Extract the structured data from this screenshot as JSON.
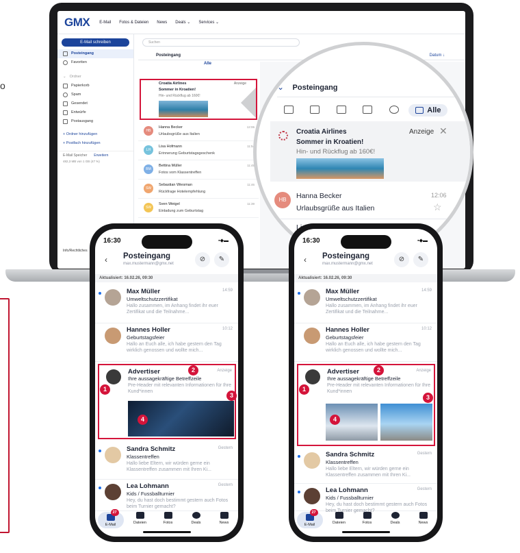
{
  "side_letter": "o",
  "laptop": {
    "logo": "GMX",
    "nav": [
      "E-Mail",
      "Fotos & Dateien",
      "News",
      "Deals ⌄",
      "Services ⌄"
    ],
    "compose_label": "E-Mail schreiben",
    "search_placeholder": "Suchen",
    "list_header": "Posteingang",
    "sort_label": "Datum ↓",
    "sidebar": {
      "top_items": [
        "Posteingang",
        "Favoriten"
      ],
      "group_label": "Ordner",
      "folders": [
        "Papierkorb",
        "Spam",
        "Gesendet",
        "Entwürfe",
        "Postausgang"
      ],
      "add_folder": "+ Ordner hinzufügen",
      "add_mailbox": "+ Postfach hinzufügen",
      "storage_label": "E-Mail Speicher",
      "storage_upgrade": "Erweitern",
      "storage_value": "482,3 MB von 1 GB (47 %)",
      "footer": "Info/Rechtliches"
    },
    "ad": {
      "sender": "Croatia Airlines",
      "label": "Anzeige",
      "subject": "Sommer in Kroatien!",
      "preheader": "Hin- und Rückflug ab 160€!"
    },
    "rows": [
      {
        "initials": "HB",
        "color": "#e58b7d",
        "name": "Hanna Becker",
        "time": "12:06",
        "subject": "Urlaubsgrüße aus Italien"
      },
      {
        "initials": "LH",
        "color": "#77c3dd",
        "name": "Lisa Hofmann",
        "time": "11:54",
        "subject": "Erinnerung Geburtstagsgeschenk"
      },
      {
        "initials": "BM",
        "color": "#7fb0e6",
        "name": "Bettina Müller",
        "time": "11:49",
        "subject": "Fotos vom Klassentreffen"
      },
      {
        "initials": "SW",
        "color": "#f0a66f",
        "name": "Sebastian Wiesman",
        "time": "11:46",
        "subject": "Rückfrage Hotelempfehlung"
      },
      {
        "initials": "SW",
        "color": "#f3c555",
        "name": "Sven Weigel",
        "time": "11:39",
        "subject": "Einladung zum Geburtstag"
      }
    ]
  },
  "magnifier": {
    "header": "Posteingang",
    "filter_all": "Alle",
    "ad_sender": "Croatia Airlines",
    "ad_label": "Anzeige",
    "ad_subject": "Sommer in Kroatien!",
    "ad_preheader": "Hin- und Rückflug ab 160€!",
    "row1_initials": "HB",
    "row1_name": "Hanna Becker",
    "row1_time": "12:06",
    "row1_subject": "Urlaubsgrüße aus Italien",
    "row2_name": "Lisa Hofmann"
  },
  "phone": {
    "time": "16:30",
    "title": "Posteingang",
    "email": "max.mustermann@gmx.net",
    "updated": "Aktualisiert: 16.02.26, 09:30",
    "mails_top": [
      {
        "name": "Max Müller",
        "time": "14:59",
        "subject": "Umweltschutzzertifikat",
        "preview": "Hallo zusammen, im Anhang findet ihr euer Zertifikat und die Teilnahme..."
      },
      {
        "name": "Hannes Holler",
        "time": "10:12",
        "subject": "Geburtstagsfeier",
        "preview": "Hallo an Euch alle, ich habe gestern den Tag wirklich genossen und wollte mich..."
      }
    ],
    "ad": {
      "name": "Advertiser",
      "label": "Anzeige",
      "subject": "Ihre aussagekräftige Betreffzeile",
      "preview": "Pre-Header mit relevanten Informationen für Ihre Kund*innen"
    },
    "mails_bottom": [
      {
        "name": "Sandra Schmitz",
        "time": "Gestern",
        "subject": "Klassentreffen",
        "preview": "Hallo liebe Eltern, wir würden gerne ein Klassentreffen zusammen mit Ihren Ki..."
      },
      {
        "name": "Lea Lohmann",
        "time": "Gestern",
        "subject": "Kids / Fussballturnier",
        "preview": "Hey, du hast doch bestimmt gestern auch Fotos beim Turnier gemacht?"
      }
    ],
    "tabs": [
      "E-Mail",
      "Dateien",
      "Fotos",
      "Deals",
      "News"
    ],
    "badge": "27",
    "markers": [
      "1",
      "2",
      "3",
      "4"
    ]
  }
}
